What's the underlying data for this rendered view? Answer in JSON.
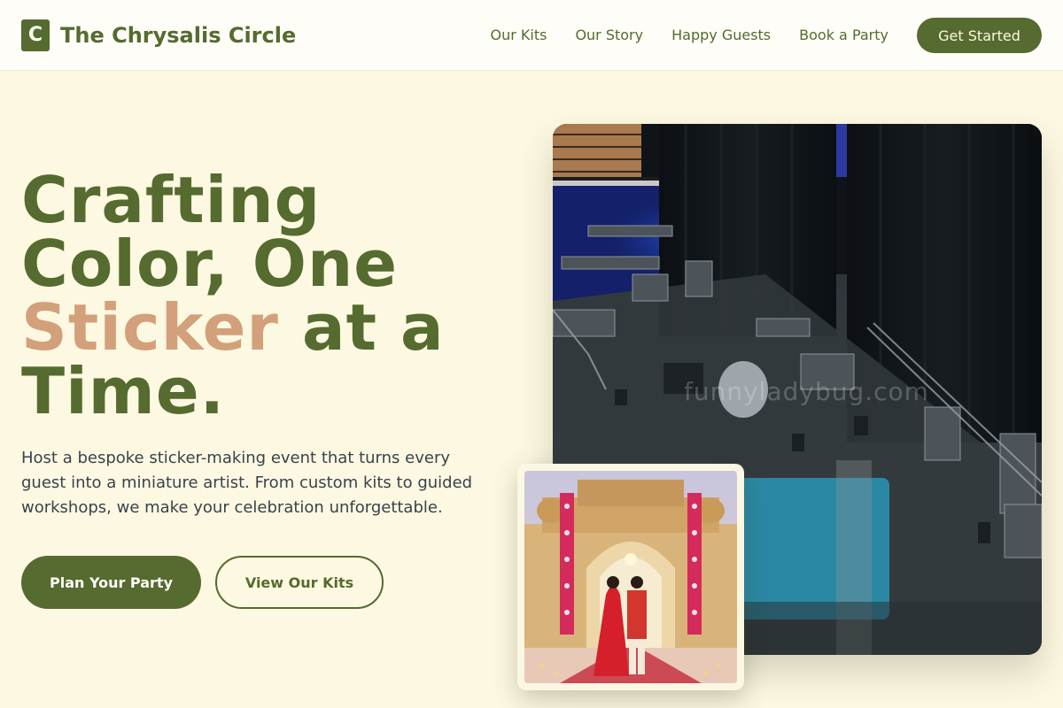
{
  "brand": {
    "mark": "C",
    "name": "The Chrysalis Circle"
  },
  "nav": {
    "links": [
      "Our Kits",
      "Our Story",
      "Happy Guests",
      "Book a Party"
    ],
    "cta": "Get Started"
  },
  "hero": {
    "title_line1": "Crafting",
    "title_line2": "Color, One",
    "title_accent": "Sticker",
    "title_line3_rest": " at a",
    "title_line4": "Time.",
    "description": "Host a bespoke sticker-making event that turns every guest into a miniature artist. From custom kits to guided workshops, we make your celebration unforgettable.",
    "primary_button": "Plan Your Party",
    "secondary_button": "View Our Kits"
  },
  "images": {
    "main_watermark": "funnyladybug.com",
    "main_icon": "event-venue-photo",
    "inset_icon": "wedding-couple-photo"
  },
  "colors": {
    "primary": "#556b2f",
    "accent": "#d2a07a",
    "background": "#fdf8e1"
  }
}
